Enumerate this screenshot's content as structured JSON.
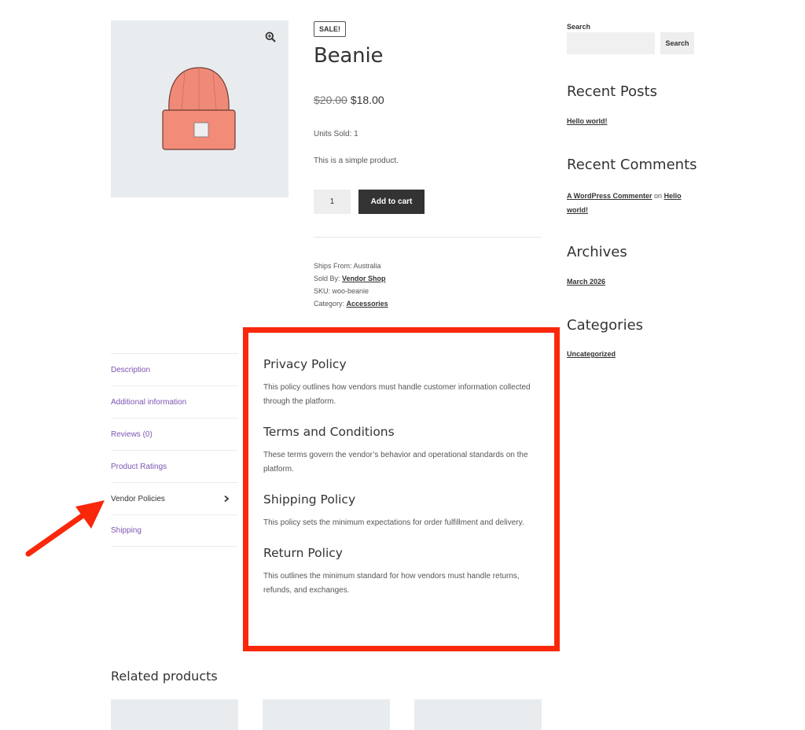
{
  "product": {
    "sale_badge": "SALE!",
    "title": "Beanie",
    "price_old": "$20.00",
    "price_new": "$18.00",
    "units_sold": "Units Sold: 1",
    "short_description": "This is a simple product.",
    "quantity": "1",
    "add_to_cart": "Add to cart",
    "meta": {
      "ships_from_label": "Ships From:",
      "ships_from_value": "Australia",
      "sold_by_label": "Sold By:",
      "sold_by_value": "Vendor Shop",
      "sku_label": "SKU:",
      "sku_value": "woo-beanie",
      "category_label": "Category:",
      "category_value": "Accessories"
    }
  },
  "sidebar": {
    "search_label": "Search",
    "search_button": "Search",
    "recent_posts": {
      "title": "Recent Posts",
      "items": [
        "Hello world!"
      ]
    },
    "recent_comments": {
      "title": "Recent Comments",
      "author": "A WordPress Commenter",
      "on": "on",
      "post": "Hello world!"
    },
    "archives": {
      "title": "Archives",
      "items": [
        "March 2026"
      ]
    },
    "categories": {
      "title": "Categories",
      "items": [
        "Uncategorized"
      ]
    }
  },
  "tabs": [
    {
      "label": "Description"
    },
    {
      "label": "Additional information"
    },
    {
      "label": "Reviews (0)"
    },
    {
      "label": "Product Ratings"
    },
    {
      "label": "Vendor Policies",
      "active": true
    },
    {
      "label": "Shipping"
    }
  ],
  "policies": [
    {
      "title": "Privacy Policy",
      "text": "This policy outlines how vendors must handle customer information collected through the platform."
    },
    {
      "title": "Terms and Conditions",
      "text": "These terms govern the vendor’s behavior and operational standards on the platform."
    },
    {
      "title": "Shipping Policy",
      "text": "This policy sets the minimum expectations for order fulfillment and delivery."
    },
    {
      "title": "Return Policy",
      "text": "This outlines the minimum standard for how vendors must handle returns, refunds, and exchanges."
    }
  ],
  "related": {
    "title": "Related products"
  },
  "colors": {
    "highlight": "#f9280b",
    "tab_link": "#7f54b3",
    "button_dark": "#333333",
    "placeholder_bg": "#e9ecef"
  },
  "icons": [
    "zoom-icon",
    "chevron-right-icon",
    "annotation-arrow"
  ]
}
